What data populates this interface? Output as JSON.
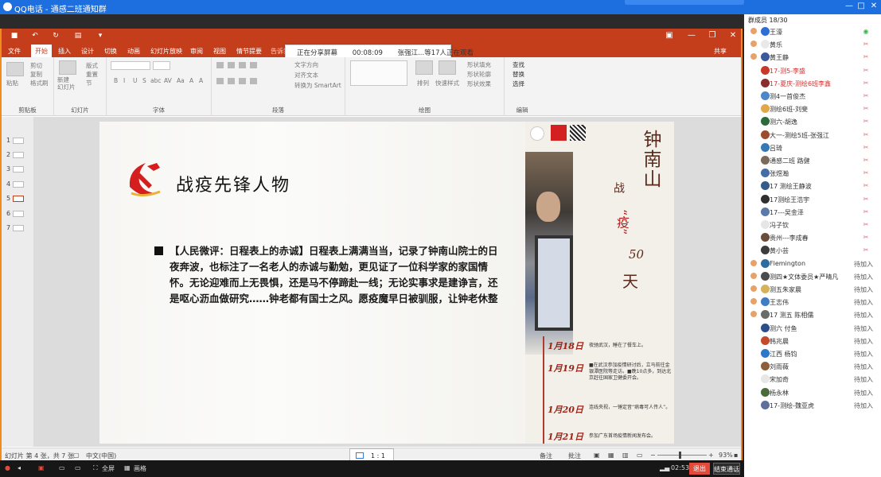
{
  "qq": {
    "title": "QQ电话 - 通感二班通知群",
    "window_controls": [
      "—",
      "□",
      "✕"
    ]
  },
  "share_banner": {
    "status": "正在分享屏幕",
    "time": "00:08:09",
    "viewers": "张强江...等17人正在观看"
  },
  "ppt": {
    "window_controls": [
      "▣",
      "—",
      "❐",
      "✕"
    ],
    "tabs": [
      "文件",
      "开始",
      "插入",
      "设计",
      "切换",
      "动画",
      "幻灯片放映",
      "审阅",
      "视图",
      "情节提要"
    ],
    "active_tab": "开始",
    "search_hint": "告诉我您想要做什么...",
    "share_label": "共享",
    "ribbon": {
      "clipboard": {
        "paste": "粘贴",
        "cut": "剪切",
        "copy": "复制",
        "format_painter": "格式刷",
        "group": "剪贴板"
      },
      "slides": {
        "new_slide": "新建\n幻灯片",
        "layout": "版式",
        "reset": "重置",
        "section": "节",
        "group": "幻灯片"
      },
      "font": {
        "group": "字体",
        "buttons": [
          "B",
          "I",
          "U",
          "S",
          "abc",
          "AV",
          "Aa",
          "A",
          "A"
        ]
      },
      "paragraph": {
        "text_direction": "文字方向",
        "align_text": "对齐文本",
        "smartart": "转换为 SmartArt",
        "group": "段落"
      },
      "drawing": {
        "arrange": "排列",
        "quick_styles": "快速样式",
        "fill": "形状填充",
        "outline": "形状轮廓",
        "effects": "形状效果",
        "group": "绘图"
      },
      "editing": {
        "find": "查找",
        "replace": "替换",
        "select": "选择",
        "group": "编辑"
      }
    },
    "thumbnails": [
      "1",
      "2",
      "3",
      "4",
      "5",
      "6",
      "7"
    ],
    "active_slide": "5",
    "slide": {
      "title": "战疫先锋人物",
      "body": "【人民微评：日程表上的赤诚】日程表上满满当当，记录了钟南山院士的日夜奔波，也标注了一名老人的赤诚与勤勉，更见证了一位科学家的家国情怀。无论迎难而上无畏惧，还是马不停蹄赴一线；无论实事求是建诤言，还是呕心沥血做研究……钟老都有国士之风。愿疫魔早日被驯服，让钟老休整",
      "poster": {
        "name": "钟南山",
        "war": "战",
        "epidemic": "“疫”",
        "fifty": "50",
        "days": "天",
        "timeline": [
          {
            "date": "1月18日",
            "text": "夜驰武汉，睡在了餐车上。"
          },
          {
            "date": "1月19日",
            "text": "■在武汉参加疫情研讨后，立马前往金银潭医院等走访。■晚10点多，到达北京赶往国家卫健委开会。"
          },
          {
            "date": "1月20日",
            "text": "连线央视，一锤定音“病毒可人传人”。"
          },
          {
            "date": "1月21日",
            "text": "参加广东首场疫情新闻发布会。"
          }
        ]
      }
    },
    "status": {
      "slide_info": "幻灯片 第 4 张，共 7 张",
      "language": "中文(中国)",
      "notes": "备注",
      "comments": "批注",
      "zoom": "93%",
      "zoom_level_percent": 93
    },
    "ratio_popup": "1 : 1"
  },
  "bottom": {
    "fullscreen": "全屏",
    "mode": "画格",
    "timer": "02:53",
    "exit": "退出",
    "end_call": "结束通话"
  },
  "members": {
    "header": "群成员 18/30",
    "list": [
      {
        "name": "王濠",
        "status": "mic-on",
        "host": true,
        "color": "#2f6fd3"
      },
      {
        "name": "黄乐",
        "status": "muted",
        "host": true,
        "color": "#e9e9e9"
      },
      {
        "name": "黄王静",
        "status": "muted",
        "host": true,
        "color": "#3a5a9c"
      },
      {
        "name": "17-测5-李盛",
        "status": "muted",
        "host": false,
        "red": true,
        "color": "#c73a2b"
      },
      {
        "name": "17-夏庆-测绘6班李鑫",
        "status": "muted",
        "host": false,
        "red": true,
        "color": "#8a2e2e"
      },
      {
        "name": "测4一首俊杰",
        "status": "muted",
        "host": false,
        "color": "#4a88c7"
      },
      {
        "name": "测绘6班-刘斐",
        "status": "muted",
        "host": false,
        "color": "#e1a74a"
      },
      {
        "name": "测六-胡逸",
        "status": "muted",
        "host": false,
        "color": "#2b6b3b"
      },
      {
        "name": "大一-测绘5班-张强江",
        "status": "muted",
        "host": false,
        "color": "#9b4d2d"
      },
      {
        "name": "吕琦",
        "status": "muted",
        "host": false,
        "color": "#3478b5"
      },
      {
        "name": "通感二班 路健",
        "status": "muted",
        "host": false,
        "color": "#7a6b5a"
      },
      {
        "name": "张煜瀚",
        "status": "muted",
        "host": false,
        "color": "#446da8"
      },
      {
        "name": "17 测绘王静波",
        "status": "muted",
        "host": false,
        "color": "#355b8a"
      },
      {
        "name": "17测绘王浩宇",
        "status": "muted",
        "host": false,
        "color": "#2f2f2f"
      },
      {
        "name": "17---吴金泽",
        "status": "muted",
        "host": false,
        "color": "#5c7aa8"
      },
      {
        "name": "冯子钦",
        "status": "muted",
        "host": false,
        "color": "#e6e6e6"
      },
      {
        "name": "贵州---李成春",
        "status": "muted",
        "host": false,
        "color": "#6a4d3c"
      },
      {
        "name": "黄小芸",
        "status": "muted",
        "host": false,
        "color": "#3c3c3c"
      },
      {
        "name": "Flemington",
        "status": "待加入",
        "host": true,
        "color": "#2e6c9e"
      },
      {
        "name": "测四★文体委员★严晴凡",
        "status": "待加入",
        "host": true,
        "color": "#4c4c4c"
      },
      {
        "name": "测五朱家晨",
        "status": "待加入",
        "host": true,
        "color": "#d6b25a"
      },
      {
        "name": "王志伟",
        "status": "待加入",
        "host": true,
        "color": "#3f7cc2"
      },
      {
        "name": "17 测五 陈相儒",
        "status": "待加入",
        "host": true,
        "color": "#6b6b6b"
      },
      {
        "name": "测六 付鱼",
        "status": "待加入",
        "host": false,
        "color": "#2c4f8a"
      },
      {
        "name": "韩兆晨",
        "status": "待加入",
        "host": false,
        "color": "#c44b2a"
      },
      {
        "name": "江西 杨钧",
        "status": "待加入",
        "host": false,
        "color": "#2d79c7"
      },
      {
        "name": "刘雨薇",
        "status": "待加入",
        "host": false,
        "color": "#8b5f3b"
      },
      {
        "name": "宋加奇",
        "status": "待加入",
        "host": false,
        "color": "#e7e7e7"
      },
      {
        "name": "杨永林",
        "status": "待加入",
        "host": false,
        "color": "#4a6b3a"
      },
      {
        "name": "17-测绘-魏亚虎",
        "status": "待加入",
        "host": false,
        "color": "#5d6f9a"
      }
    ]
  },
  "colors": {
    "ppt_red": "#c43e1c",
    "share_border": "#f18b1d",
    "qq_blue": "#1d6fe0",
    "exit_red": "#e24b3c"
  }
}
